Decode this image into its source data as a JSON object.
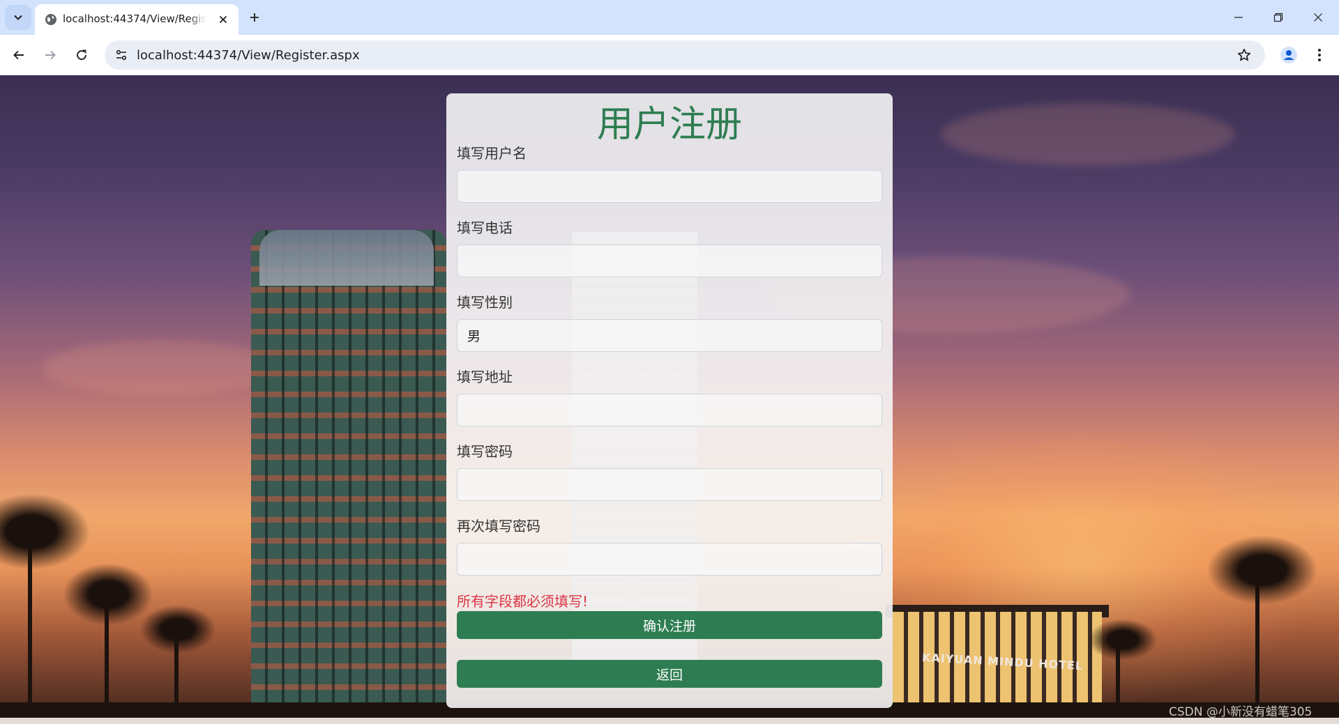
{
  "browser": {
    "tab": {
      "title": "localhost:44374/View/Register.aspx",
      "favicon": "globe-icon",
      "close_icon": "close-icon"
    },
    "new_tab_icon": "plus-icon",
    "window_controls": [
      "minimize-icon",
      "restore-icon",
      "close-icon"
    ],
    "nav": {
      "back_icon": "arrow-left-icon",
      "forward_icon": "arrow-right-icon",
      "reload_icon": "reload-icon"
    },
    "address_bar": {
      "url": "localhost:44374/View/Register.aspx",
      "site_info_icon": "tune-icon",
      "bookmark_icon": "star-icon"
    },
    "profile_icon": "person-icon",
    "menu_icon": "more-vertical-icon",
    "colors": {
      "tabbar_bg": "#d3e3fd",
      "omnibox_bg": "#e9eef6"
    }
  },
  "page": {
    "title": "用户注册",
    "fields": [
      {
        "label": "填写用户名",
        "value": "",
        "placeholder": ""
      },
      {
        "label": "填写电话",
        "value": "",
        "placeholder": ""
      },
      {
        "label": "填写性别",
        "value": "男",
        "placeholder": ""
      },
      {
        "label": "填写地址",
        "value": "",
        "placeholder": ""
      },
      {
        "label": "填写密码",
        "value": "",
        "placeholder": ""
      },
      {
        "label": "再次填写密码",
        "value": "",
        "placeholder": ""
      }
    ],
    "error_message": "所有字段都必须填写!",
    "buttons": {
      "confirm": "确认注册",
      "back": "返回"
    },
    "background_sign": "KAIYUAN MINDU HOTEL",
    "watermark": "CSDN @小新没有蜡笔305",
    "colors": {
      "accent": "#2e7d52",
      "error": "#dc3545",
      "card_bg": "#f5f5f5"
    }
  }
}
